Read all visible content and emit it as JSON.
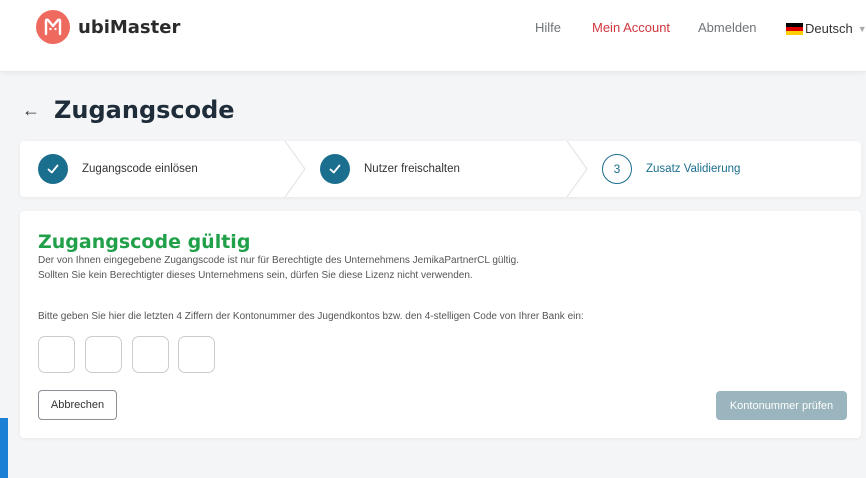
{
  "header": {
    "logo_text": "ubiMaster",
    "nav": {
      "help": "Hilfe",
      "account": "Mein Account",
      "logout": "Abmelden"
    },
    "language": "Deutsch",
    "accent_color": "#d2363f"
  },
  "page": {
    "title": "Zugangscode"
  },
  "stepper": {
    "steps": [
      {
        "label": "Zugangscode einlösen",
        "state": "done"
      },
      {
        "label": "Nutzer freischalten",
        "state": "done"
      },
      {
        "label": "Zusatz Validierung",
        "state": "active",
        "number": "3"
      }
    ],
    "color": "#1a6e8e"
  },
  "card": {
    "title": "Zugangscode gültig",
    "info_line1": "Der von Ihnen eingegebene Zugangscode ist nur für Berechtigte des Unternehmens JemikaPartnerCL gültig.",
    "info_line2": "Sollten Sie kein Berechtigter dieses Unternehmens sein, dürfen Sie diese Lizenz nicht verwenden.",
    "prompt": "Bitte geben Sie hier die letzten 4 Ziffern der Kontonummer des Jugendkontos bzw. den 4-stelligen Code von Ihrer Bank ein:",
    "digits": [
      "",
      "",
      "",
      ""
    ],
    "cancel_label": "Abbrechen",
    "submit_label": "Kontonummer prüfen",
    "success_color": "#21a04a"
  }
}
